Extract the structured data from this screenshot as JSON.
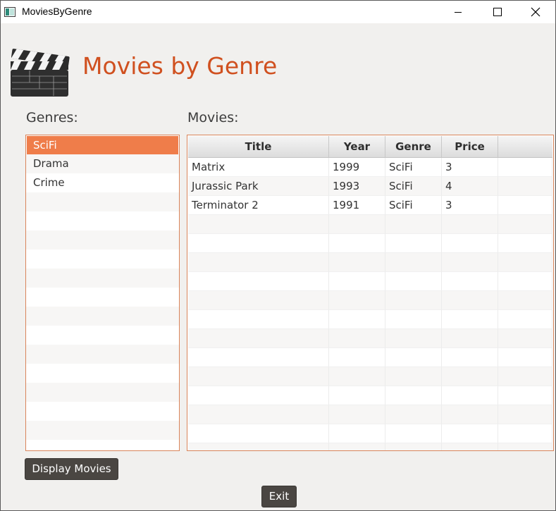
{
  "window": {
    "title": "MoviesByGenre"
  },
  "header": {
    "title": "Movies by Genre"
  },
  "genres": {
    "label": "Genres:",
    "items": [
      "SciFi",
      "Drama",
      "Crime"
    ],
    "selected": "SciFi"
  },
  "movies": {
    "label": "Movies:",
    "columns": [
      "Title",
      "Year",
      "Genre",
      "Price"
    ],
    "rows": [
      {
        "title": "Matrix",
        "year": "1999",
        "genre": "SciFi",
        "price": "3"
      },
      {
        "title": "Jurassic Park",
        "year": "1993",
        "genre": "SciFi",
        "price": "4"
      },
      {
        "title": "Terminator 2",
        "year": "1991",
        "genre": "SciFi",
        "price": "3"
      }
    ]
  },
  "buttons": {
    "display_movies": "Display Movies",
    "exit": "Exit"
  },
  "colors": {
    "accent": "#d0501f",
    "selection": "#ef7d4a",
    "button_bg": "#4a4642"
  },
  "icons": {
    "app": "app-window-icon",
    "logo": "clapperboard-icon",
    "minimize": "minimize-icon",
    "maximize": "maximize-icon",
    "close": "close-icon"
  }
}
